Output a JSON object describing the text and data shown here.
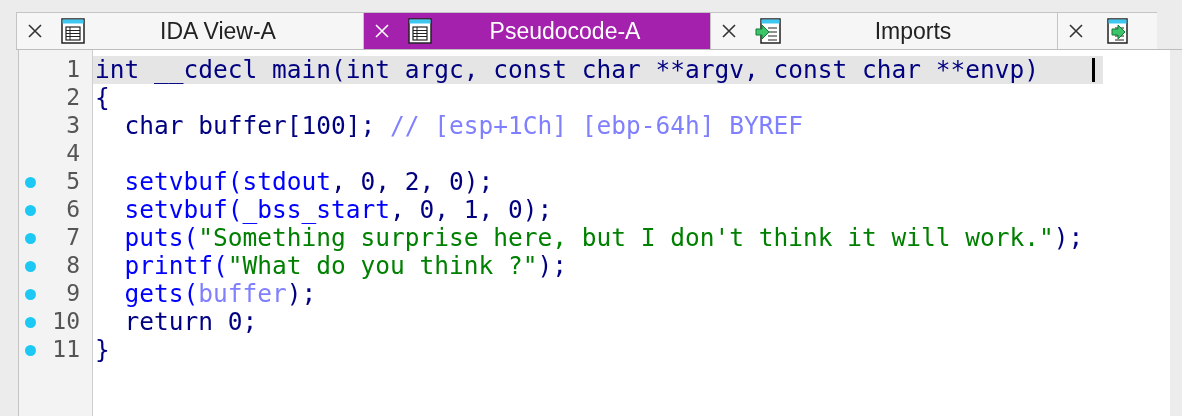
{
  "tabs": [
    {
      "label": "IDA View-A",
      "kind": "table",
      "selected": false
    },
    {
      "label": "Pseudocode-A",
      "kind": "table",
      "selected": true
    },
    {
      "label": "Imports",
      "kind": "import",
      "selected": false
    },
    {
      "kind": "export",
      "selected": false
    }
  ],
  "code": {
    "lines": [
      {
        "number": "1",
        "breakpoint": false,
        "current": true,
        "tokens": [
          {
            "text": "int __cdecl main(int argc, const char **argv, const char **envp)",
            "kind": "plain"
          }
        ]
      },
      {
        "number": "2",
        "breakpoint": false,
        "current": false,
        "tokens": [
          {
            "text": "{",
            "kind": "plain"
          }
        ]
      },
      {
        "number": "3",
        "breakpoint": false,
        "current": false,
        "tokens": [
          {
            "text": "  char buffer[100]; ",
            "kind": "plain"
          },
          {
            "text": "// [esp+1Ch] [ebp-64h] BYREF",
            "kind": "comment"
          }
        ]
      },
      {
        "number": "4",
        "breakpoint": false,
        "current": false
      },
      {
        "number": "5",
        "breakpoint": true,
        "current": false,
        "tokens": [
          {
            "text": "  setvbuf(stdout",
            "kind": "func"
          },
          {
            "text": ", 0, 2, 0);",
            "kind": "plain"
          }
        ]
      },
      {
        "number": "6",
        "breakpoint": true,
        "current": false,
        "tokens": [
          {
            "text": "  setvbuf(_bss_start",
            "kind": "func"
          },
          {
            "text": ", 0, 1, 0);",
            "kind": "plain"
          }
        ]
      },
      {
        "number": "7",
        "breakpoint": true,
        "current": false,
        "tokens": [
          {
            "text": "  puts(",
            "kind": "func"
          },
          {
            "text": "\"Something surprise here, but I don't think it will work.\"",
            "kind": "string"
          },
          {
            "text": ");",
            "kind": "plain"
          }
        ]
      },
      {
        "number": "8",
        "breakpoint": true,
        "current": false,
        "tokens": [
          {
            "text": "  printf(",
            "kind": "func"
          },
          {
            "text": "\"What do you think ?\"",
            "kind": "string"
          },
          {
            "text": ");",
            "kind": "plain"
          }
        ]
      },
      {
        "number": "9",
        "breakpoint": true,
        "current": false,
        "tokens": [
          {
            "text": "  gets(",
            "kind": "func"
          },
          {
            "text": "buffer",
            "kind": "comment"
          },
          {
            "text": ");",
            "kind": "plain"
          }
        ]
      },
      {
        "number": "10",
        "breakpoint": true,
        "current": false,
        "tokens": [
          {
            "text": "  return 0;",
            "kind": "plain"
          }
        ]
      },
      {
        "number": "11",
        "breakpoint": true,
        "current": false,
        "tokens": [
          {
            "text": "}",
            "kind": "plain"
          }
        ]
      }
    ]
  }
}
